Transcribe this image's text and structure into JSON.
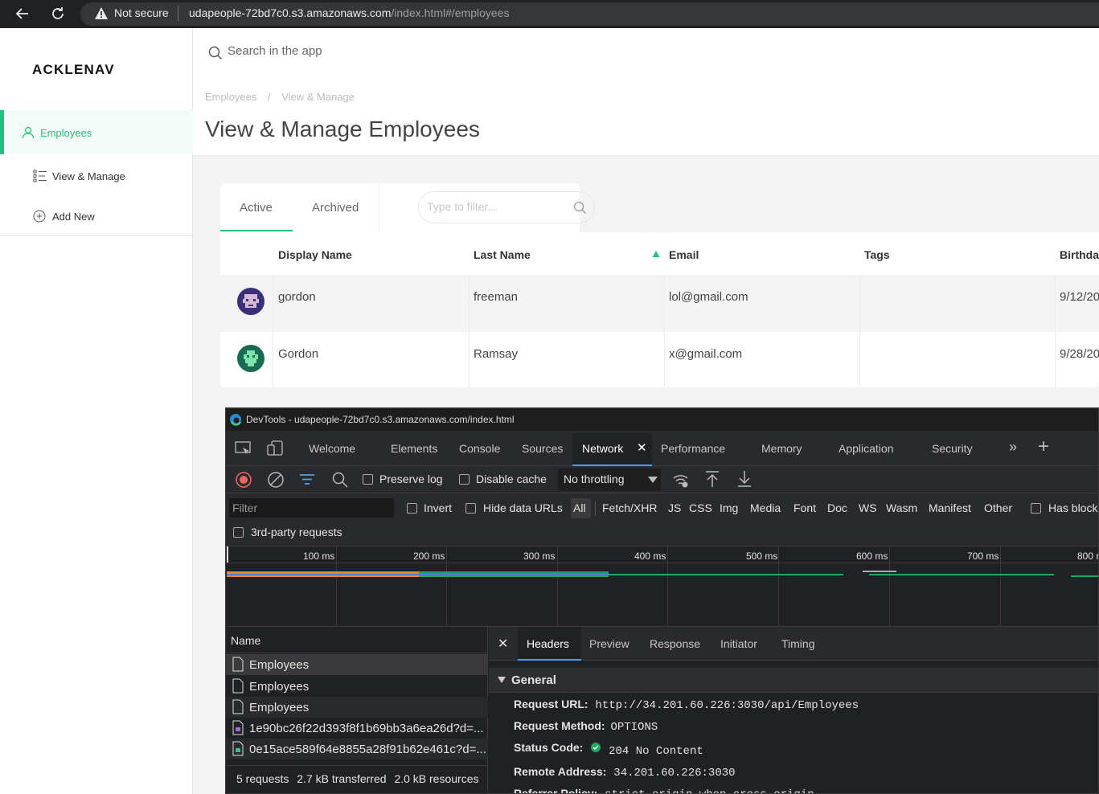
{
  "browser": {
    "security_label": "Not secure",
    "url_host": "udapeople-72bd7c0.s3.amazonaws.com",
    "url_path": "/index.html#/employees"
  },
  "sidebar": {
    "logo": "ACKLENAV",
    "items": [
      {
        "label": "Employees",
        "icon": "user-icon",
        "active": true
      },
      {
        "label": "View & Manage",
        "icon": "list-icon"
      },
      {
        "label": "Add New",
        "icon": "plus-circle-icon"
      }
    ]
  },
  "header": {
    "search_placeholder": "Search in the app",
    "breadcrumb": [
      "Employees",
      "View & Manage"
    ],
    "breadcrumb_sep": "/",
    "title": "View & Manage Employees"
  },
  "tabs": {
    "active_label": "Active",
    "archived_label": "Archived",
    "filter_placeholder": "Type to filter..."
  },
  "table": {
    "columns": [
      "Display Name",
      "Last Name",
      "Email",
      "Tags",
      "Birthda"
    ],
    "sort_column": "Email",
    "rows": [
      {
        "display_name": "gordon",
        "last_name": "freeman",
        "email": "lol@gmail.com",
        "tags": "",
        "birthday": "9/12/20"
      },
      {
        "display_name": "Gordon",
        "last_name": "Ramsay",
        "email": "x@gmail.com",
        "tags": "",
        "birthday": "9/28/20"
      }
    ]
  },
  "devtools": {
    "title": "DevTools - udapeople-72bd7c0.s3.amazonaws.com/index.html",
    "tabs": [
      "Welcome",
      "Elements",
      "Console",
      "Sources",
      "Network",
      "Performance",
      "Memory",
      "Application",
      "Security"
    ],
    "active_tab": "Network",
    "toolbar": {
      "preserve_log": "Preserve log",
      "disable_cache": "Disable cache",
      "throttling": "No throttling"
    },
    "filter": {
      "placeholder": "Filter",
      "invert": "Invert",
      "hide_data_urls": "Hide data URLs",
      "types": [
        "All",
        "Fetch/XHR",
        "JS",
        "CSS",
        "Img",
        "Media",
        "Font",
        "Doc",
        "WS",
        "Wasm",
        "Manifest",
        "Other"
      ],
      "has_blocked": "Has block",
      "third_party": "3rd-party requests"
    },
    "timeline": {
      "ticks": [
        "100 ms",
        "200 ms",
        "300 ms",
        "400 ms",
        "500 ms",
        "600 ms",
        "700 ms",
        "800 r"
      ]
    },
    "requests": {
      "header": "Name",
      "items": [
        {
          "name": "Employees",
          "type": "doc"
        },
        {
          "name": "Employees",
          "type": "doc"
        },
        {
          "name": "Employees",
          "type": "doc"
        },
        {
          "name": "1e90bc26f22d393f8f1b69bb3a6ea26d?d=...",
          "type": "img"
        },
        {
          "name": "0e15ace589f64e8855a28f91b62e461c?d=...",
          "type": "img"
        }
      ],
      "summary": [
        "5 requests",
        "2.7 kB transferred",
        "2.0 kB resources"
      ]
    },
    "detail_tabs": [
      "Headers",
      "Preview",
      "Response",
      "Initiator",
      "Timing"
    ],
    "active_detail_tab": "Headers",
    "general": {
      "title": "General",
      "fields": [
        {
          "key": "Request URL:",
          "value": "http://34.201.60.226:3030/api/Employees"
        },
        {
          "key": "Request Method:",
          "value": "OPTIONS"
        },
        {
          "key": "Status Code:",
          "value": "204 No Content"
        },
        {
          "key": "Remote Address:",
          "value": "34.201.60.226:3030"
        },
        {
          "key": "Referrer Policy:",
          "value": "strict-origin-when-cross-origin"
        }
      ]
    }
  },
  "colors": {
    "accent": "#22c17d",
    "devtools_bg": "#202124",
    "network_blue": "#4a9ff5"
  }
}
